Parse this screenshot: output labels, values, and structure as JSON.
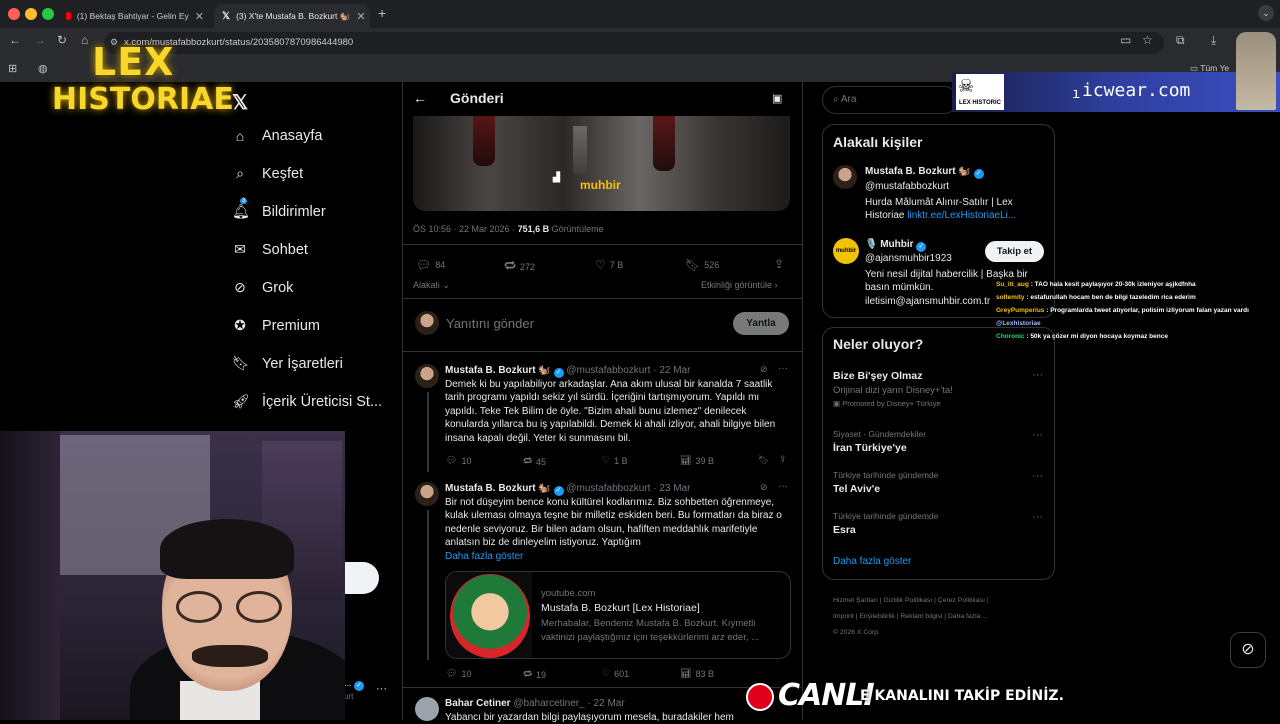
{
  "browser": {
    "tabs": [
      {
        "label": "(1) Bektaş Bahtiyar - Gelin Ey",
        "active": false
      },
      {
        "label": "(3) X'te Mustafa B. Bozkurt 🐿️",
        "active": true
      }
    ],
    "url": "x.com/mustafabbozkurt/status/2035807870986444980",
    "bookmark_label": "Tüm Ye"
  },
  "overlay": {
    "logo_line1": "LEX",
    "logo_line2": "HISTORIAE",
    "brand_url": "icwear.com",
    "brand_prefix": "ı",
    "brand_tag": "LEX HISTORIC",
    "live_label": "CANLI",
    "ticker": "E KANALINI TAKİP EDİNİZ.",
    "chat": [
      {
        "user": "Su_iti_aug",
        "text": ": TAO hala kesit paylaşıyor 20-30k izleniyor aşjkdfnha",
        "color": "#f5c400"
      },
      {
        "user": "soltemity",
        "text": ": estafurullah hocam ben de bilgi tazeledim rica ederim",
        "color": "#f5c400"
      },
      {
        "user": "GreyPumperius",
        "text": ": Programlarda tweet atıyorlar, polisim izliyorum falan yazan vardı",
        "color": "#f5c400"
      },
      {
        "user": "@Lexhistoriae",
        "text": "",
        "color": "#9fb6ff"
      },
      {
        "user": "Choronic",
        "text": ": 50k ya çözer mi diyon hocaya koymaz bence",
        "color": "#00e676"
      }
    ]
  },
  "sidebar": {
    "items": [
      {
        "label": "Anasayfa",
        "icon": "home-icon"
      },
      {
        "label": "Keşfet",
        "icon": "search-icon"
      },
      {
        "label": "Bildirimler",
        "icon": "bell-icon",
        "badge": "3"
      },
      {
        "label": "Sohbet",
        "icon": "mail-icon"
      },
      {
        "label": "Grok",
        "icon": "grok-icon"
      },
      {
        "label": "Premium",
        "icon": "premium-icon"
      },
      {
        "label": "Yer İşaretleri",
        "icon": "bookmark-icon"
      },
      {
        "label": "İçerik Üreticisi St...",
        "icon": "rocket-icon"
      }
    ]
  },
  "post": {
    "header_title": "Gönderi",
    "media_brand": "muhbir",
    "timestamp": "ÖS 10:56 · 22 Mar 2026 · ",
    "views": "751,6 B",
    "views_label": " Görüntüleme",
    "stats": {
      "replies": "84",
      "reposts": "272",
      "likes": "7 B",
      "bookmarks": "526"
    },
    "sort_label": "Alakalı",
    "activity_link": "Etkinliği görüntüle",
    "reply_placeholder": "Yanıtını gönder",
    "reply_button": "Yantla"
  },
  "replies": [
    {
      "name": "Mustafa B. Bozkurt 🐿️",
      "handle": "@mustafabbozkurt · 22 Mar",
      "text": "Demek ki bu yapılabiliyor arkadaşlar. Ana akım ulusal bir kanalda 7 saatlik tarih programı yapıldı sekiz yıl sürdü. İçeriğini tartışmıyorum. Yapıldı mı yapıldı. Teke Tek Bilim de öyle. \"Bizim ahali bunu izlemez\" denilecek konularda yıllarca bu iş yapılabildi. Demek ki ahali izliyor, ahali bilgiye bilen insana kapalı değil. Yeter ki sunmasını bil.",
      "replies": "10",
      "reposts": "45",
      "likes": "1 B",
      "views": "39 B"
    },
    {
      "name": "Mustafa B. Bozkurt 🐿️",
      "handle": "@mustafabbozkurt · 23 Mar",
      "text": "Bir not düşeyim bence konu kültürel kodlarımız. Biz sohbetten öğrenmeye, kulak uleması olmaya teşne bir milletiz eskiden beri. Bu formatları da biraz o nedenle seviyoruz. Bir bilen adam olsun, hafiften meddahlık marifetiyle anlatsın biz de dinleyelim istiyoruz. Yaptığım",
      "more": "Daha fazla göster",
      "link_domain": "youtube.com",
      "link_title": "Mustafa B. Bozkurt [Lex Historiae]",
      "link_desc": "Merhabalar, Benden​iz Mustafa B. Bozkurt. Kıymetli vaktinizi paylaştığınız için teşekkürlerimi arz eder, ...",
      "replies": "10",
      "reposts": "19",
      "likes": "601",
      "views": "83 B"
    },
    {
      "name": "Bahar Cetiner",
      "handle": "@baharcetiner_ · 22 Mar",
      "text": "Yabancı bir yazardan bilgi paylaşıyorum mesela, buradakiler hem"
    }
  ],
  "right": {
    "search_placeholder": "Ara",
    "people_title": "Alakalı kişiler",
    "people": [
      {
        "name": "Mustafa B. Bozkurt 🐿️",
        "handle": "@mustafabbozkurt",
        "bio": "Hurda Mâlumât Alınır-Satılır | Lex Historiae ",
        "bio_link": "linktr.ee/LexHistoriaeLi..."
      },
      {
        "name": "🎙️ Muhbir",
        "handle": "@ajansmuhbir1923",
        "bio": "Yeni nesil dijital habercilik | Başka bir basın mümkün. iletisim@ajansmuhbir.com.tr",
        "follow": "Takip et"
      }
    ],
    "trends_title": "Neler oluyor?",
    "trends": [
      {
        "meta": "",
        "title": "Bize Bi'şey Olmaz",
        "sub": "Orijinal dizi yarın Disney+'ta!",
        "promo": "Promoted by Disney+ Türkiye"
      },
      {
        "meta": "Siyaset · Gündemdekiler",
        "title": "İran Türkiye'ye"
      },
      {
        "meta": "Türkiye tarihinde gündemde",
        "title": "Tel Aviv'e"
      },
      {
        "meta": "Türkiye tarihinde gündemde",
        "title": "Esra"
      }
    ],
    "show_more": "Daha fazla göster",
    "footer": [
      "Hizmet Şartları",
      "Gizlilik Politikası",
      "Çerez Politikası",
      "Imprint",
      "Erişilebilirlik",
      "Reklam bilgisi",
      "Daha fazla ...",
      "© 2026 X Corp."
    ]
  },
  "colors": {
    "accent": "#1d9bf0",
    "live": "#e0001b",
    "logo": "#f6d72a"
  }
}
